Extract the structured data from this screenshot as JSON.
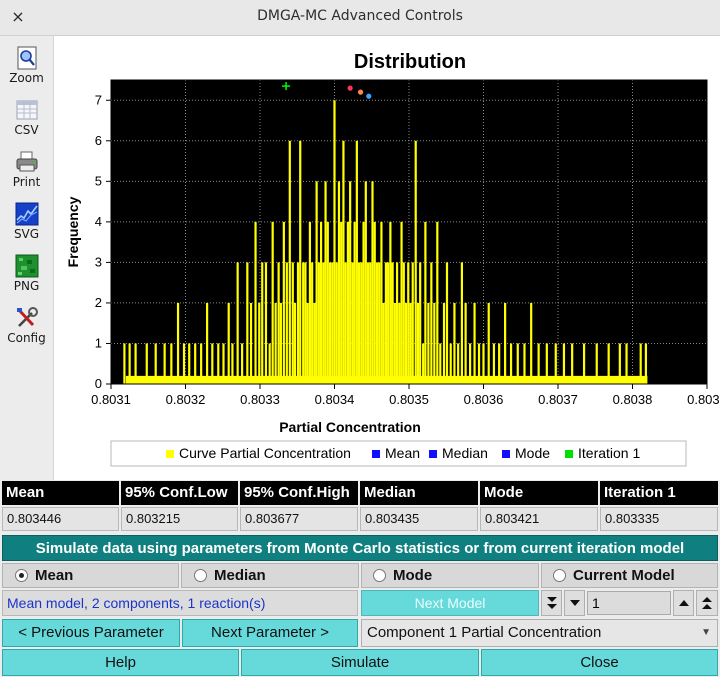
{
  "window": {
    "title": "DMGA-MC Advanced Controls",
    "close_glyph": "×"
  },
  "toolbar": {
    "items": [
      {
        "label": "Zoom",
        "icon": "zoom-icon"
      },
      {
        "label": "CSV",
        "icon": "csv-icon"
      },
      {
        "label": "Print",
        "icon": "print-icon"
      },
      {
        "label": "SVG",
        "icon": "svg-icon"
      },
      {
        "label": "PNG",
        "icon": "png-icon"
      },
      {
        "label": "Config",
        "icon": "config-icon"
      }
    ]
  },
  "chart_data": {
    "type": "bar",
    "title": "Distribution",
    "xlabel": "Partial Concentration",
    "ylabel": "Frequency",
    "xlim": [
      0.8031,
      0.8039
    ],
    "ylim": [
      0,
      7.5
    ],
    "x_ticks": [
      "0.8031",
      "0.8032",
      "0.8033",
      "0.8034",
      "0.8035",
      "0.8036",
      "0.8037",
      "0.8038",
      "0.8039"
    ],
    "y_ticks": [
      "0",
      "1",
      "2",
      "3",
      "4",
      "5",
      "6",
      "7"
    ],
    "grid": true,
    "legend_position": "bottom",
    "background": "#000000",
    "series": [
      {
        "name": "Curve Partial Concentration",
        "color": "#ffff00",
        "points": [
          [
            0.803118,
            1
          ],
          [
            0.803125,
            1
          ],
          [
            0.803133,
            1
          ],
          [
            0.803148,
            1
          ],
          [
            0.80316,
            1
          ],
          [
            0.803172,
            1
          ],
          [
            0.803181,
            1
          ],
          [
            0.80319,
            2
          ],
          [
            0.803198,
            1
          ],
          [
            0.803205,
            1
          ],
          [
            0.803213,
            1
          ],
          [
            0.803221,
            1
          ],
          [
            0.803229,
            2
          ],
          [
            0.803236,
            1
          ],
          [
            0.803244,
            1
          ],
          [
            0.803251,
            1
          ],
          [
            0.803258,
            2
          ],
          [
            0.803263,
            1
          ],
          [
            0.80327,
            3
          ],
          [
            0.803276,
            1
          ],
          [
            0.803283,
            3
          ],
          [
            0.803288,
            2
          ],
          [
            0.803294,
            4
          ],
          [
            0.803299,
            2
          ],
          [
            0.803303,
            3
          ],
          [
            0.803308,
            3
          ],
          [
            0.803313,
            1
          ],
          [
            0.803317,
            4
          ],
          [
            0.803321,
            2
          ],
          [
            0.803325,
            3
          ],
          [
            0.803328,
            2
          ],
          [
            0.803332,
            4
          ],
          [
            0.803336,
            3
          ],
          [
            0.80334,
            6
          ],
          [
            0.803344,
            3
          ],
          [
            0.803347,
            2
          ],
          [
            0.803351,
            3
          ],
          [
            0.803354,
            6
          ],
          [
            0.803358,
            3
          ],
          [
            0.803361,
            3
          ],
          [
            0.803364,
            2
          ],
          [
            0.803367,
            4
          ],
          [
            0.80337,
            3
          ],
          [
            0.803373,
            2
          ],
          [
            0.803376,
            5
          ],
          [
            0.803379,
            3
          ],
          [
            0.803382,
            4
          ],
          [
            0.803385,
            3
          ],
          [
            0.803388,
            5
          ],
          [
            0.803391,
            4
          ],
          [
            0.803394,
            3
          ],
          [
            0.803397,
            3
          ],
          [
            0.8034,
            7
          ],
          [
            0.803403,
            3
          ],
          [
            0.803406,
            5
          ],
          [
            0.803409,
            4
          ],
          [
            0.803412,
            6
          ],
          [
            0.803415,
            3
          ],
          [
            0.803418,
            4
          ],
          [
            0.803421,
            5
          ],
          [
            0.803424,
            3
          ],
          [
            0.803427,
            4
          ],
          [
            0.80343,
            6
          ],
          [
            0.803433,
            3
          ],
          [
            0.803436,
            3
          ],
          [
            0.803439,
            4
          ],
          [
            0.803442,
            5
          ],
          [
            0.803445,
            3
          ],
          [
            0.803448,
            3
          ],
          [
            0.803451,
            5
          ],
          [
            0.803454,
            4
          ],
          [
            0.803457,
            3
          ],
          [
            0.80346,
            3
          ],
          [
            0.803463,
            4
          ],
          [
            0.803466,
            2
          ],
          [
            0.803469,
            3
          ],
          [
            0.803472,
            3
          ],
          [
            0.803475,
            4
          ],
          [
            0.803478,
            3
          ],
          [
            0.803481,
            2
          ],
          [
            0.803484,
            3
          ],
          [
            0.803487,
            2
          ],
          [
            0.80349,
            4
          ],
          [
            0.803493,
            3
          ],
          [
            0.803496,
            2
          ],
          [
            0.803499,
            3
          ],
          [
            0.803502,
            2
          ],
          [
            0.803505,
            3
          ],
          [
            0.803509,
            6
          ],
          [
            0.803512,
            2
          ],
          [
            0.803515,
            3
          ],
          [
            0.803519,
            1
          ],
          [
            0.803522,
            4
          ],
          [
            0.803526,
            2
          ],
          [
            0.80353,
            3
          ],
          [
            0.803534,
            2
          ],
          [
            0.803538,
            4
          ],
          [
            0.803542,
            1
          ],
          [
            0.803547,
            2
          ],
          [
            0.803551,
            3
          ],
          [
            0.803556,
            1
          ],
          [
            0.803561,
            2
          ],
          [
            0.803566,
            1
          ],
          [
            0.803571,
            3
          ],
          [
            0.803576,
            2
          ],
          [
            0.803582,
            1
          ],
          [
            0.803588,
            2
          ],
          [
            0.803594,
            1
          ],
          [
            0.8036,
            1
          ],
          [
            0.803607,
            2
          ],
          [
            0.803614,
            1
          ],
          [
            0.803621,
            1
          ],
          [
            0.803629,
            2
          ],
          [
            0.803637,
            1
          ],
          [
            0.803646,
            1
          ],
          [
            0.803655,
            1
          ],
          [
            0.803664,
            2
          ],
          [
            0.803674,
            1
          ],
          [
            0.803685,
            1
          ],
          [
            0.803697,
            1
          ],
          [
            0.803708,
            1
          ],
          [
            0.803719,
            1
          ],
          [
            0.803735,
            1
          ],
          [
            0.803752,
            1
          ],
          [
            0.803768,
            1
          ],
          [
            0.803783,
            1
          ],
          [
            0.803792,
            1
          ],
          [
            0.803811,
            1
          ],
          [
            0.803818,
            1
          ]
        ]
      },
      {
        "name": "Mean",
        "color": "#0000ff",
        "x": 0.803446,
        "y": 7.1
      },
      {
        "name": "Median",
        "color": "#0000ff",
        "x": 0.803435,
        "y": 7.2
      },
      {
        "name": "Mode",
        "color": "#0000ff",
        "x": 0.803421,
        "y": 7.3
      },
      {
        "name": "Iteration 1",
        "color": "#00ff00",
        "x": 0.803335,
        "y": 7.35
      }
    ]
  },
  "stats": {
    "headers": [
      "Mean",
      "95% Conf.Low",
      "95% Conf.High",
      "Median",
      "Mode",
      "Iteration 1"
    ],
    "values": [
      "0.803446",
      "0.803215",
      "0.803677",
      "0.803435",
      "0.803421",
      "0.803335"
    ]
  },
  "banner": "Simulate data using parameters from Monte Carlo statistics or from current iteration model",
  "radio": {
    "options": [
      "Mean",
      "Median",
      "Mode",
      "Current Model"
    ],
    "selected": "Mean"
  },
  "model_info": "Mean model, 2 components, 1 reaction(s)",
  "next_model_label": "Next Model",
  "iteration_counter": "1",
  "nav": {
    "prev_label": "< Previous Parameter",
    "next_label": "Next Parameter >",
    "component_selected": "Component 1 Partial Concentration"
  },
  "buttons": {
    "help": "Help",
    "simulate": "Simulate",
    "close": "Close"
  }
}
